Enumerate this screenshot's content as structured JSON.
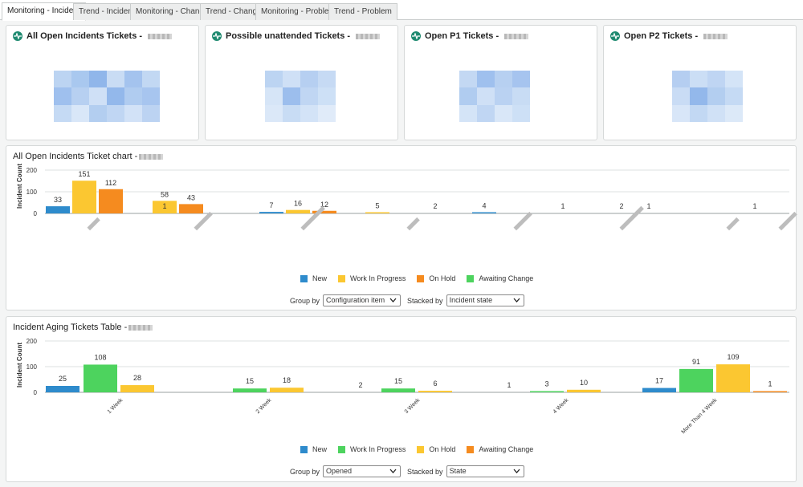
{
  "tabs": [
    {
      "label": "Monitoring - Incident",
      "active": true
    },
    {
      "label": "Trend - Incident",
      "active": false
    },
    {
      "label": "Monitoring - Change",
      "active": false
    },
    {
      "label": "Trend - Change",
      "active": false
    },
    {
      "label": "Monitoring - Problem",
      "active": false
    },
    {
      "label": "Trend - Problem",
      "active": false
    }
  ],
  "tiles": [
    {
      "title": "All Open Incidents Tickets -"
    },
    {
      "title": "Possible unattended Tickets -"
    },
    {
      "title": "Open P1 Tickets -"
    },
    {
      "title": "Open P2 Tickets -"
    }
  ],
  "chart1": {
    "title": "All Open Incidents Ticket chart -",
    "legend": [
      "New",
      "Work In Progress",
      "On Hold",
      "Awaiting Change"
    ],
    "group_by_label": "Group by",
    "group_by_value": "Configuration item",
    "stacked_by_label": "Stacked by",
    "stacked_by_value": "Incident state"
  },
  "chart2": {
    "title": "Incident Aging Tickets Table -",
    "legend": [
      "New",
      "Work In Progress",
      "On Hold",
      "Awaiting Change"
    ],
    "group_by_label": "Group by",
    "group_by_value": "Opened",
    "stacked_by_label": "Stacked by",
    "stacked_by_value": "State"
  },
  "colors": {
    "new": "#2e8bcc",
    "work_in_progress": "#fbc731",
    "on_hold": "#f58b1f",
    "awaiting_change": "#4dd35e",
    "brand_icon": "#1f8a70"
  },
  "chart_data": [
    {
      "type": "bar",
      "title": "All Open Incidents Ticket chart -",
      "ylabel": "Incident Count",
      "ylim": [
        0,
        200
      ],
      "yticks": [
        0,
        100,
        200
      ],
      "grid": true,
      "legend_position": "bottom",
      "categories": [
        "",
        "",
        "",
        "",
        "",
        "",
        "",
        ""
      ],
      "series": [
        {
          "name": "New",
          "color": "#2e8bcc",
          "values": [
            33,
            null,
            7,
            null,
            4,
            null,
            null,
            null
          ]
        },
        {
          "name": "Work In Progress",
          "color": "#fbc731",
          "values": [
            151,
            58,
            16,
            5,
            null,
            null,
            null,
            null
          ]
        },
        {
          "name": "On Hold",
          "color": "#f58b1f",
          "values": [
            112,
            43,
            12,
            null,
            null,
            null,
            null,
            null
          ]
        },
        {
          "name": "Awaiting Change",
          "color": "#4dd35e",
          "values": [
            null,
            null,
            null,
            null,
            null,
            null,
            null,
            null
          ]
        }
      ],
      "data_labels": [
        {
          "category": 0,
          "values": [
            33,
            151,
            112
          ]
        },
        {
          "category": 1,
          "values": [
            1,
            58,
            43
          ]
        },
        {
          "category": 2,
          "values": [
            7,
            16,
            12
          ]
        },
        {
          "category": 3,
          "values": [
            5,
            2
          ]
        },
        {
          "category": 4,
          "values": [
            4
          ]
        },
        {
          "category": 5,
          "values": [
            1
          ]
        },
        {
          "category": 6,
          "values": [
            2,
            1
          ]
        },
        {
          "category": 7,
          "values": [
            1
          ]
        }
      ]
    },
    {
      "type": "bar",
      "title": "Incident Aging Tickets Table -",
      "ylabel": "Incident Count",
      "ylim": [
        0,
        200
      ],
      "yticks": [
        0,
        100,
        200
      ],
      "grid": true,
      "legend_position": "bottom",
      "categories": [
        "1 Week",
        "2 Week",
        "3 Week",
        "4 Week",
        "More Than 4 Week"
      ],
      "series": [
        {
          "name": "New",
          "color": "#2e8bcc",
          "values": [
            25,
            null,
            null,
            null,
            17
          ]
        },
        {
          "name": "Work In Progress",
          "color": "#4dd35e",
          "values": [
            108,
            15,
            15,
            3,
            91
          ]
        },
        {
          "name": "On Hold",
          "color": "#fbc731",
          "values": [
            28,
            18,
            6,
            10,
            109
          ]
        },
        {
          "name": "Awaiting Change",
          "color": "#f58b1f",
          "values": [
            null,
            null,
            null,
            null,
            1
          ]
        }
      ],
      "extra_labels": [
        {
          "category": 2,
          "value": 2
        },
        {
          "category": 3,
          "value": 1
        }
      ]
    }
  ]
}
